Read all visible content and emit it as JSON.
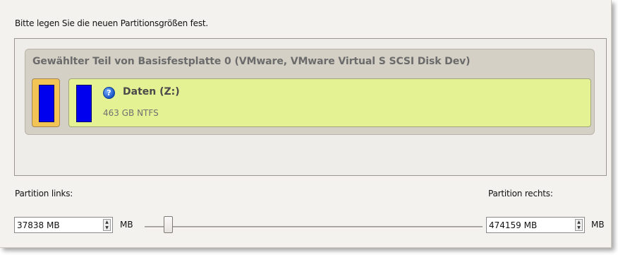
{
  "instruction": "Bitte legen Sie die neuen Partitionsgrößen fest.",
  "disk": {
    "title": "Gewählter Teil von Basisfestplatte 0 (VMware, VMware Virtual S SCSI Disk Dev)",
    "partition": {
      "name": "Daten (Z:)",
      "info": "463 GB NTFS"
    }
  },
  "left": {
    "label": "Partition links:",
    "value": "37838 MB",
    "unit": "MB"
  },
  "right": {
    "label": "Partition rechts:",
    "value": "474159 MB",
    "unit": "MB"
  },
  "slider": {
    "position_fraction": 0.06
  },
  "colors": {
    "partition_fill": "#e4f294",
    "unallocated_fill": "#f1c455",
    "used_bar": "#0000ee",
    "disk_panel": "#d5d0c6"
  },
  "icons": {
    "partition_status": "help-icon"
  }
}
